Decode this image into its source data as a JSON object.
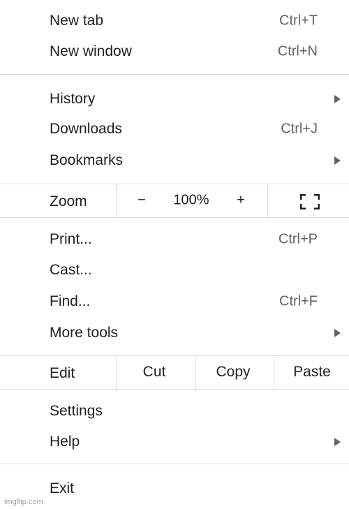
{
  "menu": {
    "new_tab": {
      "label": "New tab",
      "shortcut": "Ctrl+T"
    },
    "new_window": {
      "label": "New window",
      "shortcut": "Ctrl+N"
    },
    "history": {
      "label": "History"
    },
    "downloads": {
      "label": "Downloads",
      "shortcut": "Ctrl+J"
    },
    "bookmarks": {
      "label": "Bookmarks"
    },
    "zoom": {
      "label": "Zoom",
      "minus": "−",
      "value": "100%",
      "plus": "+",
      "fullscreen_icon": "fullscreen-icon"
    },
    "print": {
      "label": "Print...",
      "shortcut": "Ctrl+P"
    },
    "cast": {
      "label": "Cast..."
    },
    "find": {
      "label": "Find...",
      "shortcut": "Ctrl+F"
    },
    "more_tools": {
      "label": "More tools"
    },
    "edit": {
      "label": "Edit",
      "cut": "Cut",
      "copy": "Copy",
      "paste": "Paste"
    },
    "settings": {
      "label": "Settings"
    },
    "help": {
      "label": "Help"
    },
    "exit": {
      "label": "Exit"
    }
  },
  "watermark": "imgflip.com"
}
